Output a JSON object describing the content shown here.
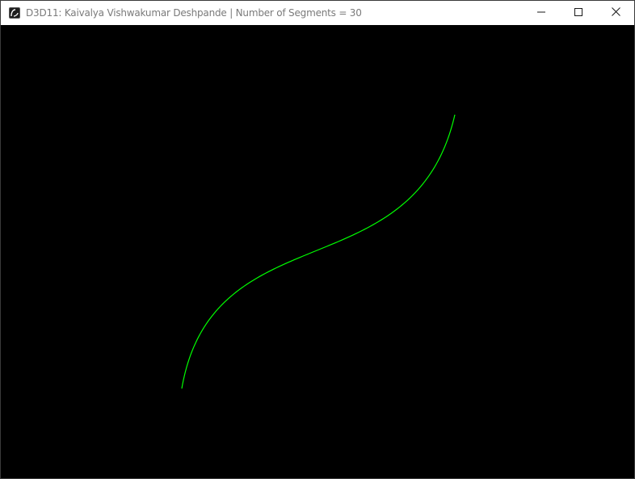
{
  "window": {
    "title": "D3D11: Kaivalya Vishwakumar Deshpande | Number of Segments = 30",
    "icon": "app-icon",
    "caption_buttons": [
      "minimize-icon",
      "maximize-icon",
      "close-icon"
    ]
  },
  "canvas": {
    "background": "#000000",
    "curve_color": "#00ff00",
    "num_segments": 30
  }
}
